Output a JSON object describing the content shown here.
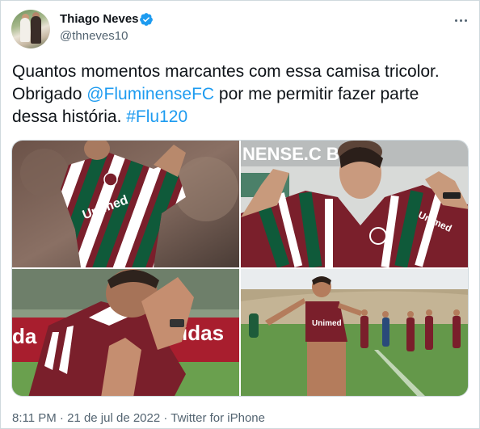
{
  "author": {
    "name": "Thiago Neves",
    "handle": "@thneves10",
    "verified": true
  },
  "tweet": {
    "text_part1": "Quantos momentos marcantes com essa camisa tricolor. Obrigado ",
    "mention": "@FluminenseFC",
    "text_part2": " por me permitir fazer parte dessa história. ",
    "hashtag": "#Flu120",
    "photo_texts": {
      "photo1_shirt": "Unimed",
      "photo2_banner": "NENSE.C   BR",
      "photo2_shirt": "Unimed",
      "photo3_board": "idas",
      "photo4_shirt": "Unimed"
    }
  },
  "footer": {
    "time": "8:11 PM",
    "date": "21 de jul de 2022",
    "source": "Twitter for iPhone",
    "separator": " · "
  },
  "colors": {
    "link": "#1d9bf0",
    "text": "#0f1419",
    "secondary": "#536471",
    "border": "#cfd9de",
    "flu_maroon": "#7a1f2b",
    "flu_green": "#0f5a3a"
  }
}
